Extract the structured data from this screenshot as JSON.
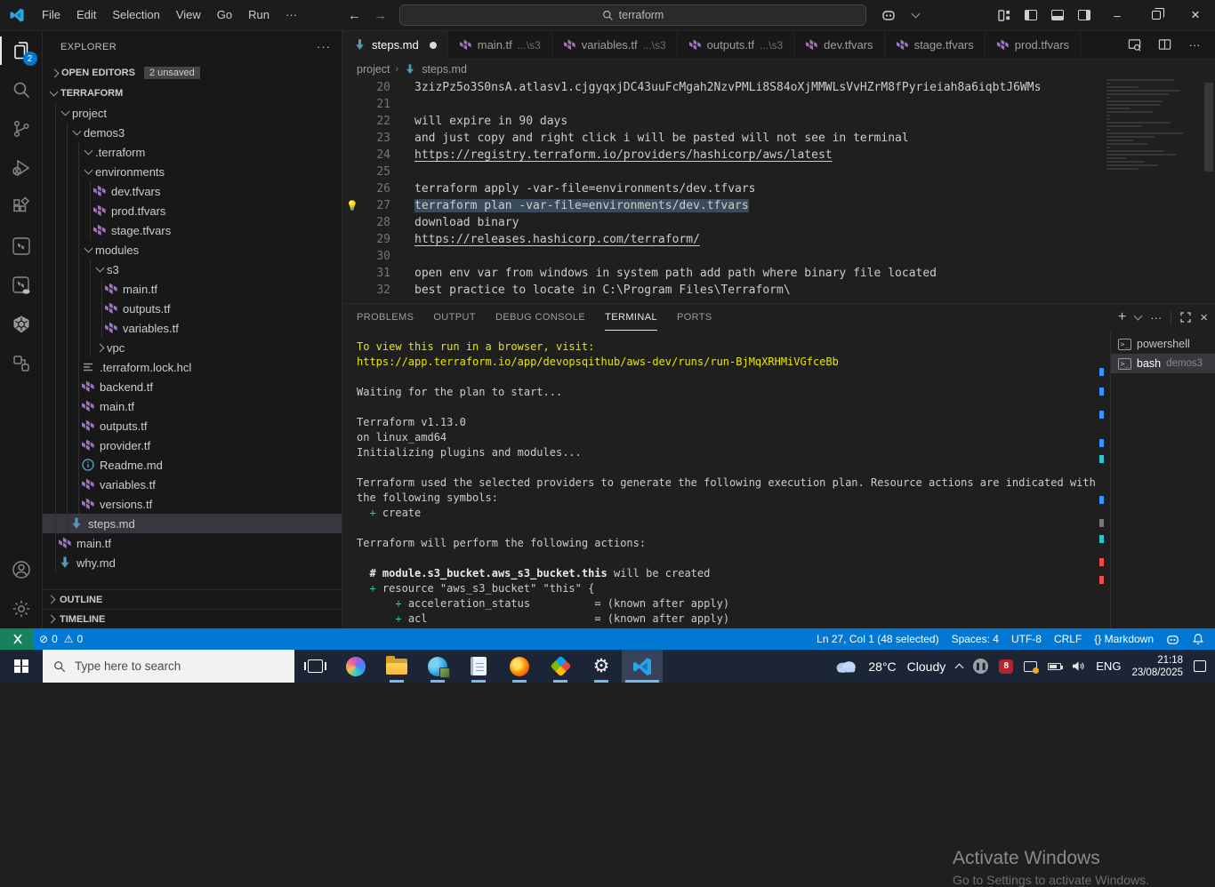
{
  "icons": {
    "more": "···",
    "add": "+",
    "close": "×",
    "minimize": "–"
  },
  "titlebar": {
    "menus": [
      "File",
      "Edit",
      "Selection",
      "View",
      "Go",
      "Run",
      "···"
    ],
    "search_value": "terraform"
  },
  "activity_bar": {
    "badge": "2",
    "items": [
      {
        "name": "explorer",
        "active": true,
        "badge": "2"
      },
      {
        "name": "search"
      },
      {
        "name": "source-control"
      },
      {
        "name": "run-debug"
      },
      {
        "name": "extensions"
      },
      {
        "name": "terraform"
      },
      {
        "name": "terraform-cloud"
      },
      {
        "name": "kubernetes"
      },
      {
        "name": "remote-explorer"
      }
    ],
    "bottom": [
      {
        "name": "accounts"
      },
      {
        "name": "settings"
      }
    ]
  },
  "sidebar": {
    "title": "EXPLORER",
    "more": "···",
    "open_editors_label": "OPEN EDITORS",
    "open_editors_badge": "2 unsaved",
    "tree": [
      {
        "label": "TERRAFORM",
        "level": 0,
        "kind": "root",
        "chev": "down"
      },
      {
        "label": "project",
        "level": 1,
        "kind": "folder",
        "chev": "down"
      },
      {
        "label": "demos3",
        "level": 2,
        "kind": "folder",
        "chev": "down"
      },
      {
        "label": ".terraform",
        "level": 3,
        "kind": "folder",
        "chev": "down"
      },
      {
        "label": "environments",
        "level": 3,
        "kind": "folder",
        "chev": "down"
      },
      {
        "label": "dev.tfvars",
        "level": 4,
        "kind": "file",
        "icon": "terraform"
      },
      {
        "label": "prod.tfvars",
        "level": 4,
        "kind": "file",
        "icon": "terraform"
      },
      {
        "label": "stage.tfvars",
        "level": 4,
        "kind": "file",
        "icon": "terraform"
      },
      {
        "label": "modules",
        "level": 3,
        "kind": "folder",
        "chev": "down"
      },
      {
        "label": "s3",
        "level": 4,
        "kind": "folder",
        "chev": "down"
      },
      {
        "label": "main.tf",
        "level": 5,
        "kind": "file",
        "icon": "terraform"
      },
      {
        "label": "outputs.tf",
        "level": 5,
        "kind": "file",
        "icon": "terraform"
      },
      {
        "label": "variables.tf",
        "level": 5,
        "kind": "file",
        "icon": "terraform"
      },
      {
        "label": "vpc",
        "level": 4,
        "kind": "folder",
        "chev": "right"
      },
      {
        "label": ".terraform.lock.hcl",
        "level": 3,
        "kind": "file",
        "icon": "list"
      },
      {
        "label": "backend.tf",
        "level": 3,
        "kind": "file",
        "icon": "terraform"
      },
      {
        "label": "main.tf",
        "level": 3,
        "kind": "file",
        "icon": "terraform"
      },
      {
        "label": "outputs.tf",
        "level": 3,
        "kind": "file",
        "icon": "terraform"
      },
      {
        "label": "provider.tf",
        "level": 3,
        "kind": "file",
        "icon": "terraform"
      },
      {
        "label": "Readme.md",
        "level": 3,
        "kind": "file",
        "icon": "info"
      },
      {
        "label": "variables.tf",
        "level": 3,
        "kind": "file",
        "icon": "terraform"
      },
      {
        "label": "versions.tf",
        "level": 3,
        "kind": "file",
        "icon": "terraform"
      },
      {
        "label": "steps.md",
        "level": 2,
        "kind": "file",
        "icon": "markdown",
        "selected": true
      },
      {
        "label": "main.tf",
        "level": 1,
        "kind": "file",
        "icon": "terraform"
      },
      {
        "label": "why.md",
        "level": 1,
        "kind": "file",
        "icon": "markdown"
      }
    ],
    "outline_label": "OUTLINE",
    "timeline_label": "TIMELINE"
  },
  "editor": {
    "tabs": [
      {
        "label": "steps.md",
        "icon": "markdown",
        "active": true,
        "dirty": true
      },
      {
        "label": "main.tf",
        "suffix": "...\\s3",
        "icon": "terraform"
      },
      {
        "label": "variables.tf",
        "suffix": "...\\s3",
        "icon": "terraform"
      },
      {
        "label": "outputs.tf",
        "suffix": "...\\s3",
        "icon": "terraform"
      },
      {
        "label": "dev.tfvars",
        "icon": "terraform"
      },
      {
        "label": "stage.tfvars",
        "icon": "terraform"
      },
      {
        "label": "prod.tfvars",
        "icon": "terraform"
      }
    ],
    "breadcrumb": {
      "folder": "project",
      "file": "steps.md"
    },
    "lines": [
      {
        "num": "20",
        "text": "3zizPz5o3S0nsA.atlasv1.cjgyqxjDC43uuFcMgah2NzvPMLi8S84oXjMMWLsVvHZrM8fPyrieiah8a6iqbtJ6WMs"
      },
      {
        "num": "21",
        "text": ""
      },
      {
        "num": "22",
        "text": "will expire in 90 days"
      },
      {
        "num": "23",
        "text": "and just copy and right click i will be pasted will not see in terminal"
      },
      {
        "num": "24",
        "text": "https://registry.terraform.io/providers/hashicorp/aws/latest",
        "link": true
      },
      {
        "num": "25",
        "text": ""
      },
      {
        "num": "26",
        "text": "terraform apply -var-file=environments/dev.tfvars"
      },
      {
        "num": "27",
        "text": "terraform plan -var-file=environments/dev.tfvars",
        "selected": true,
        "lightbulb": true
      },
      {
        "num": "28",
        "text": "download binary"
      },
      {
        "num": "29",
        "text": "https://releases.hashicorp.com/terraform/",
        "link": true
      },
      {
        "num": "30",
        "text": ""
      },
      {
        "num": "31",
        "text": "open env var from windows in system path add path where binary file located"
      },
      {
        "num": "32",
        "text": "best practice to locate in C:\\Program Files\\Terraform\\"
      }
    ]
  },
  "panel": {
    "tabs": [
      "PROBLEMS",
      "OUTPUT",
      "DEBUG CONSOLE",
      "TERMINAL",
      "PORTS"
    ],
    "active_tab": "TERMINAL",
    "terminal_lines": [
      [
        {
          "t": "To view this run in a browser, visit:",
          "c": "y"
        }
      ],
      [
        {
          "t": "https://app.terraform.io/app/devopsqithub/aws-dev/runs/run-BjMqXRHMiVGfceBb",
          "c": "y"
        }
      ],
      [],
      [
        {
          "t": "Waiting for the plan to start..."
        }
      ],
      [],
      [
        {
          "t": "Terraform v1.13.0"
        }
      ],
      [
        {
          "t": "on linux_amd64"
        }
      ],
      [
        {
          "t": "Initializing plugins and modules..."
        }
      ],
      [],
      [
        {
          "t": "Terraform used the selected providers to generate the following execution plan. Resource actions are indicated with"
        }
      ],
      [
        {
          "t": "the following symbols:"
        }
      ],
      [
        {
          "t": "  "
        },
        {
          "t": "+",
          "c": "g"
        },
        {
          "t": " create"
        }
      ],
      [],
      [
        {
          "t": "Terraform will perform the following actions:"
        }
      ],
      [],
      [
        {
          "t": "  "
        },
        {
          "t": "# module.s3_bucket.aws_s3_bucket.this",
          "c": "b"
        },
        {
          "t": " will be created"
        }
      ],
      [
        {
          "t": "  "
        },
        {
          "t": "+",
          "c": "g"
        },
        {
          "t": " resource \"aws_s3_bucket\" \"this\" {"
        }
      ],
      [
        {
          "t": "      "
        },
        {
          "t": "+",
          "c": "g"
        },
        {
          "t": " acceleration_status          = (known after apply)"
        }
      ],
      [
        {
          "t": "      "
        },
        {
          "t": "+",
          "c": "g"
        },
        {
          "t": " acl                          = (known after apply)"
        }
      ]
    ],
    "terminal_list": [
      {
        "label": "powershell"
      },
      {
        "label": "bash",
        "suffix": "demos3",
        "active": true
      }
    ]
  },
  "watermark": {
    "line1": "Activate Windows",
    "line2": "Go to Settings to activate Windows."
  },
  "status_bar": {
    "errors": "0",
    "warnings": "0",
    "cursor": "Ln 27, Col 1 (48 selected)",
    "spaces": "Spaces: 4",
    "encoding": "UTF-8",
    "eol": "CRLF",
    "language": "{} Markdown"
  },
  "taskbar": {
    "search_placeholder": "Type here to search",
    "apps": [
      {
        "name": "copilot"
      },
      {
        "name": "file-explorer",
        "running": true
      },
      {
        "name": "edge",
        "running": true
      },
      {
        "name": "notepad",
        "running": true
      },
      {
        "name": "firefox",
        "running": true
      },
      {
        "name": "dev-diamond",
        "running": true
      },
      {
        "name": "settings",
        "running": true
      },
      {
        "name": "vscode",
        "active": true
      }
    ],
    "weather_temp": "28°C",
    "weather_cond": "Cloudy",
    "tray_red_label": "8",
    "language": "ENG",
    "time": "21:18",
    "date": "23/08/2025"
  },
  "colors": {
    "status_blue": "#0078d4",
    "remote_green": "#16825d",
    "terraform_purple": "#a074c4",
    "markdown_blue": "#519aba",
    "terminal_yellow": "#e5e510",
    "terminal_green": "#23d18b",
    "selection": "#3a4a5a",
    "accent_underline": "#76b9ed"
  }
}
